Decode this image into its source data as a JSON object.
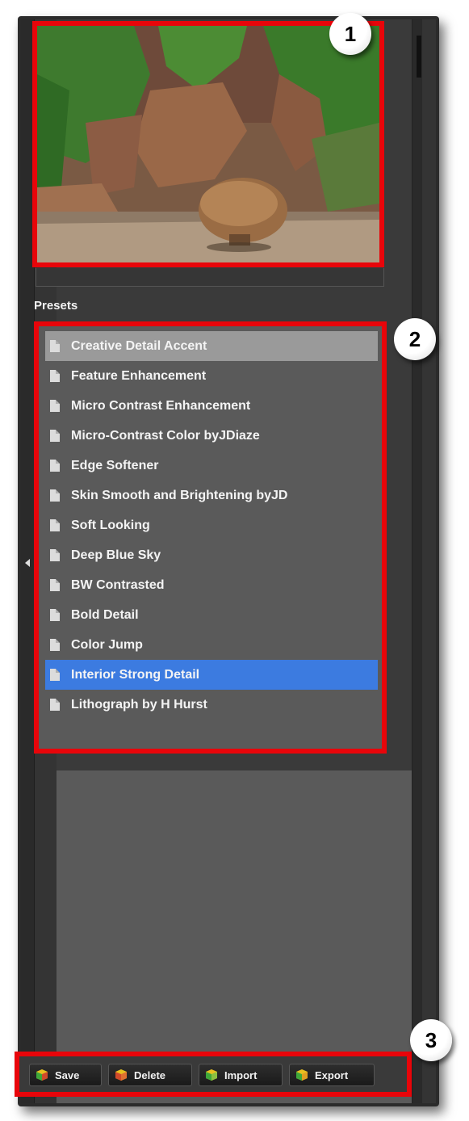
{
  "thumbnail": {
    "alt": "Preview"
  },
  "presets": {
    "title": "Presets",
    "items": [
      {
        "label": "Creative Detail Accent",
        "state": "hover"
      },
      {
        "label": "Feature Enhancement",
        "state": "normal"
      },
      {
        "label": "Micro Contrast Enhancement",
        "state": "normal"
      },
      {
        "label": "Micro-Contrast Color byJDiaze",
        "state": "normal"
      },
      {
        "label": "Edge Softener",
        "state": "normal"
      },
      {
        "label": "Skin Smooth and Brightening byJD",
        "state": "normal"
      },
      {
        "label": "Soft Looking",
        "state": "normal"
      },
      {
        "label": "Deep Blue Sky",
        "state": "normal"
      },
      {
        "label": "BW Contrasted",
        "state": "normal"
      },
      {
        "label": "Bold Detail",
        "state": "normal"
      },
      {
        "label": "Color Jump",
        "state": "normal"
      },
      {
        "label": "Interior Strong Detail",
        "state": "selected"
      },
      {
        "label": "Lithograph by H Hurst",
        "state": "normal"
      }
    ]
  },
  "buttons": {
    "save": "Save",
    "delete": "Delete",
    "import": "Import",
    "export": "Export"
  },
  "callouts": {
    "one": "1",
    "two": "2",
    "three": "3"
  },
  "colors": {
    "highlight": "#e8050a",
    "selected_row": "#3c7be0",
    "hover_row": "#9a9a9a"
  }
}
